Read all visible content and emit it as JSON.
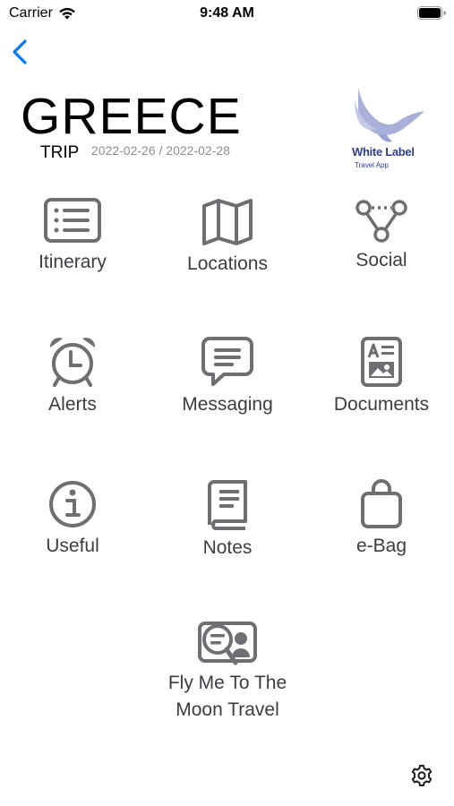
{
  "status_bar": {
    "carrier": "Carrier",
    "time": "9:48 AM"
  },
  "header": {
    "title": "GREECE",
    "subtitle": "TRIP",
    "dates": "2022-02-26 / 2022-02-28",
    "brand_name": "White Label",
    "brand_tagline": "Travel App"
  },
  "menu": [
    {
      "label": "Itinerary",
      "icon": "list-icon"
    },
    {
      "label": "Locations",
      "icon": "map-icon"
    },
    {
      "label": "Social",
      "icon": "network-icon"
    },
    {
      "label": "Alerts",
      "icon": "alarm-clock-icon"
    },
    {
      "label": "Messaging",
      "icon": "chat-bubble-icon"
    },
    {
      "label": "Documents",
      "icon": "document-icon"
    },
    {
      "label": "Useful",
      "icon": "info-icon"
    },
    {
      "label": "Notes",
      "icon": "book-icon"
    },
    {
      "label": "e-Bag",
      "icon": "bag-icon"
    },
    {
      "label_line1": "Fly Me To The",
      "label_line2": "Moon Travel",
      "icon": "agency-search-icon"
    }
  ],
  "colors": {
    "accent": "#007aff",
    "icon_gray": "#6e6e73",
    "label_gray": "#3c3c43",
    "brand": "#2f3f8f"
  }
}
